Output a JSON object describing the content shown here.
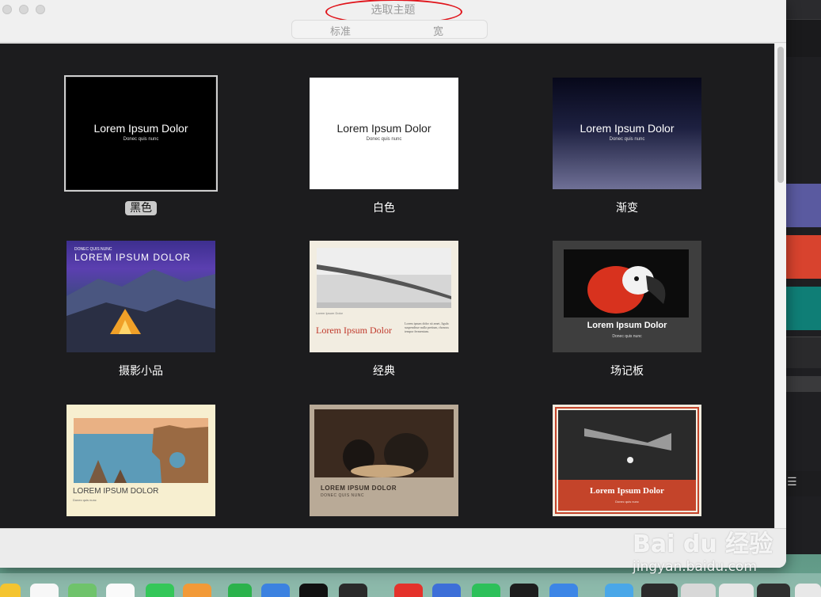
{
  "window": {
    "title": "选取主题",
    "tabs": [
      {
        "label": "标准"
      },
      {
        "label": "宽"
      }
    ]
  },
  "themes": [
    {
      "name": "黑色",
      "title": "Lorem Ipsum Dolor",
      "subtitle": "Donec quis nunc",
      "selected": true
    },
    {
      "name": "白色",
      "title": "Lorem Ipsum Dolor",
      "subtitle": "Donec quis nunc"
    },
    {
      "name": "渐变",
      "title": "Lorem Ipsum Dolor",
      "subtitle": "Donec quis nunc"
    },
    {
      "name": "摄影小品",
      "title": "LOREM IPSUM DOLOR",
      "subtitle": "DONEC QUIS NUNC"
    },
    {
      "name": "经典",
      "title": "Lorem Ipsum Dolor",
      "subtitle": "Lorem Ipsum Dolor",
      "body": "Lorem ipsum dolor sit amet, ligula suspendisse nulla pretium, rhoncus tempor fermentum."
    },
    {
      "name": "场记板",
      "title": "Lorem Ipsum Dolor",
      "subtitle": "Donec quis nunc"
    },
    {
      "name": "",
      "title": "LOREM IPSUM DOLOR",
      "subtitle": "Donec quis nunc"
    },
    {
      "name": "",
      "title": "LOREM IPSUM DOLOR",
      "subtitle": "DONEC QUIS NUNC"
    },
    {
      "name": "",
      "title": "Lorem Ipsum Dolor",
      "subtitle": "Donec quis nunc"
    }
  ],
  "background_app": {
    "glyph": "☰"
  },
  "watermark": {
    "logo": "Bai du 经验",
    "url": "jingyan.baidu.com"
  },
  "dock": {
    "icons": [
      "notes-icon",
      "reminders-icon",
      "maps-icon",
      "photos-icon",
      "messages-icon",
      "pages-icon",
      "numbers-icon",
      "keynote-icon",
      "apple-tv-icon",
      "podcasts-icon",
      "wps-icon",
      "mail-icon",
      "wechat-icon",
      "activity-monitor-icon",
      "wps-writer-icon",
      "finder-icon"
    ]
  },
  "colors": {
    "accent_circle": "#e0141b",
    "content_bg": "#1c1c1e"
  }
}
